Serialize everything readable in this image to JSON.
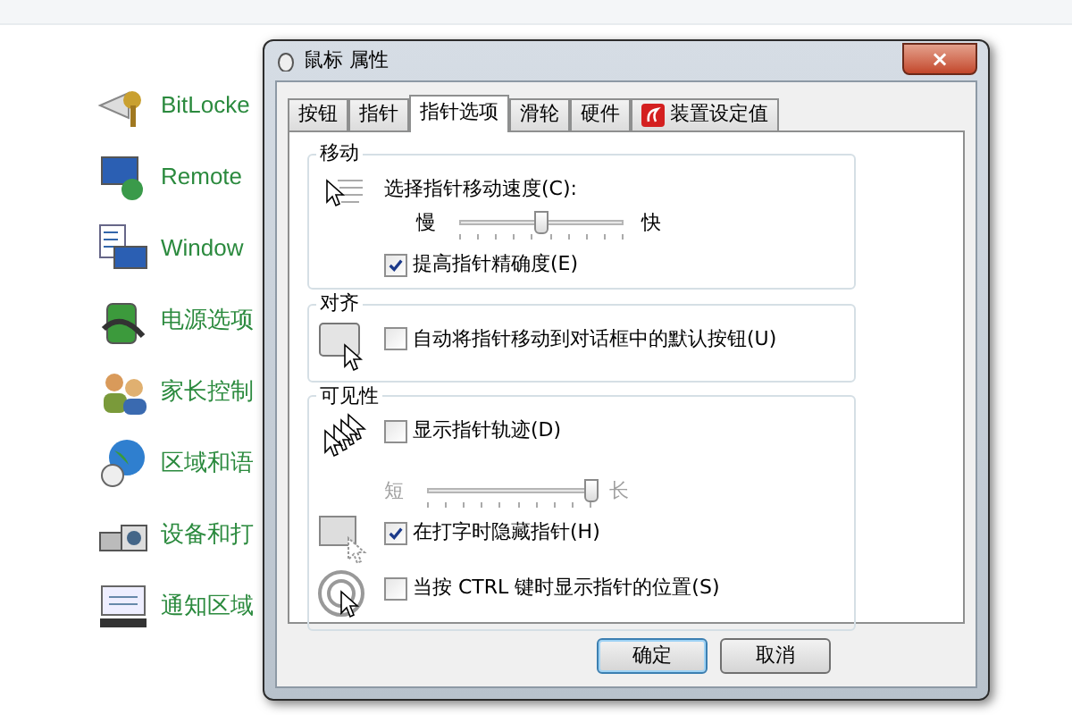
{
  "control_panel": {
    "items": [
      {
        "label": "BitLocke"
      },
      {
        "label": "Remote"
      },
      {
        "label": "Window"
      },
      {
        "label": "电源选项"
      },
      {
        "label": "家长控制"
      },
      {
        "label": "区域和语"
      },
      {
        "label": "设备和打"
      },
      {
        "label": "通知区域"
      }
    ]
  },
  "dialog": {
    "title": "鼠标 属性",
    "close": "×",
    "tabs": [
      {
        "label": "按钮",
        "selected": false
      },
      {
        "label": "指针",
        "selected": false
      },
      {
        "label": "指针选项",
        "selected": true
      },
      {
        "label": "滑轮",
        "selected": false
      },
      {
        "label": "硬件",
        "selected": false
      },
      {
        "label": "装置设定值",
        "selected": false,
        "has_icon": true
      }
    ],
    "groups": [
      {
        "title": "移动",
        "rows": [
          {
            "kind": "slider",
            "label": "选择指针移动速度(C):",
            "min_label": "慢",
            "max_label": "快",
            "level": 0.5,
            "disabled": false
          },
          {
            "kind": "checkbox",
            "label": "提高指针精确度(E)",
            "checked": true
          }
        ]
      },
      {
        "title": "对齐",
        "rows": [
          {
            "kind": "checkbox",
            "label": "自动将指针移动到对话框中的默认按钮(U)",
            "checked": false
          }
        ]
      },
      {
        "title": "可见性",
        "rows": [
          {
            "kind": "checkbox",
            "label": "显示指针轨迹(D)",
            "checked": false
          },
          {
            "kind": "slider",
            "min_label": "短",
            "max_label": "长",
            "level": 1,
            "disabled": true
          },
          {
            "kind": "checkbox",
            "label": "在打字时隐藏指针(H)",
            "checked": true
          },
          {
            "kind": "checkbox",
            "label": "当按 CTRL 键时显示指针的位置(S)",
            "checked": false
          }
        ]
      }
    ],
    "buttons": [
      {
        "label": "确定",
        "default": true
      },
      {
        "label": "取消",
        "default": false
      }
    ]
  }
}
